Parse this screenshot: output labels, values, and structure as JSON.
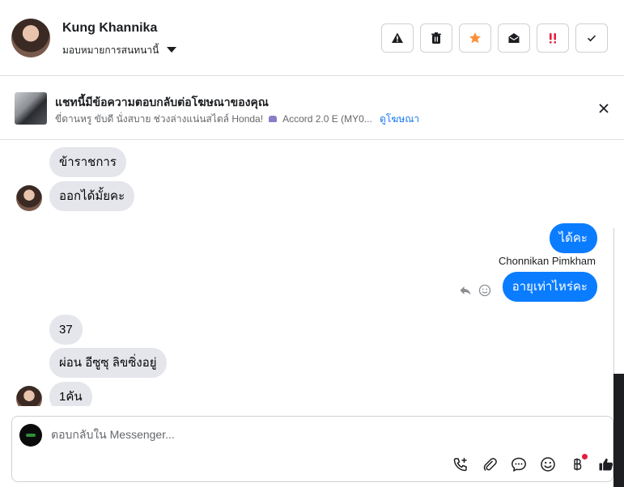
{
  "header": {
    "name": "Kung Khannika",
    "assign_label": "มอบหมายการสนทนานี้"
  },
  "actions": [
    {
      "icon": "warning-icon"
    },
    {
      "icon": "trash-icon"
    },
    {
      "icon": "star-icon",
      "color": "#f7923a"
    },
    {
      "icon": "envelope-open-icon"
    },
    {
      "icon": "double-exclamation-icon",
      "color": "#e41e3f"
    },
    {
      "icon": "check-icon"
    }
  ],
  "ad": {
    "title": "แชทนี้มีข้อความตอบกลับต่อโฆษณาของคุณ",
    "subtitle": "ขี่ดานหรู ขับดี นั่งสบาย ช่วงล่างแน่นสไตล์ Honda!",
    "model": "Accord 2.0 E (MY0...",
    "link": "ดูโฆษณา"
  },
  "messages": [
    {
      "text": "ข้าราชการ",
      "dir": "in"
    },
    {
      "text": "ออกได้มั้ยคะ",
      "dir": "in"
    },
    {
      "text": "ได้คะ",
      "dir": "out"
    },
    {
      "text": "อายุเท่าไหร่คะ",
      "dir": "out"
    },
    {
      "text": "37",
      "dir": "in"
    },
    {
      "text": "ผ่อน อีซูซุ ลิขซิ่งอยู่",
      "dir": "in"
    },
    {
      "text": "1คัน",
      "dir": "in"
    }
  ],
  "sender_name": "Chonnikan Pimkham",
  "composer": {
    "placeholder": "ตอบกลับใน Messenger..."
  },
  "colors": {
    "outgoing_bubble": "#0a7cff",
    "incoming_bubble": "#e4e6eb",
    "link": "#1877f2"
  }
}
